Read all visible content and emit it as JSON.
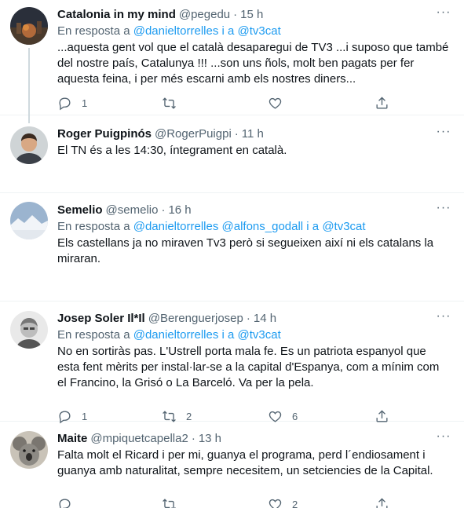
{
  "tweets": [
    {
      "name": "Catalonia in my mind",
      "handle": "@pegedu",
      "sep": "·",
      "time": "15 h",
      "reply_prefix": "En resposta a",
      "reply_mentions": "@danieltorrelles i a @tv3cat",
      "text": "...aquesta gent vol que el català desaparegui de TV3 ...i suposo que també del nostre país, Catalunya !!! ...son uns ñols, molt ben pagats per fer aquesta feina, i per més escarni amb els nostres diners...",
      "replies": "1",
      "retweets": "",
      "likes": ""
    },
    {
      "name": "Roger Puigpinós",
      "handle": "@RogerPuigpi",
      "sep": "·",
      "time": "11 h",
      "text": "El TN és a les 14:30, íntegrament en català.",
      "replies": "",
      "retweets": "",
      "likes": ""
    },
    {
      "name": "Semelio",
      "handle": "@semelio",
      "sep": "·",
      "time": "16 h",
      "reply_prefix": "En resposta a",
      "reply_mentions": "@danieltorrelles @alfons_godall i a @tv3cat",
      "text": "Els castellans ja no miraven Tv3 però si segueixen així ni els catalans la miraran.",
      "replies": "",
      "retweets": "",
      "likes": ""
    },
    {
      "name": "Josep Soler Il*Il",
      "handle": "@Berenguerjosep",
      "sep": "·",
      "time": "14 h",
      "reply_prefix": "En resposta a",
      "reply_mentions": "@danieltorrelles i a @tv3cat",
      "text": "No en sortiràs pas. L'Ustrell porta mala fe. Es un patriota espanyol que esta fent mèrits per instal·lar-se a la capital d'Espanya, com a mínim com el Francino, la Grisó o La Barceló. Va per la pela.",
      "replies": "1",
      "retweets": "2",
      "likes": "6"
    },
    {
      "name": "Maite",
      "handle": "@mpiquetcapella2",
      "sep": "·",
      "time": "13 h",
      "text": "Falta molt el Ricard i per mi, guanya el programa, perd l´endiosament i guanya amb naturalitat, sempre necesitem, un setciencies de la Capital.",
      "replies": "",
      "retweets": "",
      "likes": "2"
    }
  ],
  "icons": {
    "reply": "reply-icon",
    "retweet": "retweet-icon",
    "like": "heart-icon",
    "share": "share-icon",
    "more": "more-icon"
  },
  "colors": {
    "text": "#0f1419",
    "secondary": "#536471",
    "link": "#1d9bf0",
    "divider": "#eff3f4"
  }
}
